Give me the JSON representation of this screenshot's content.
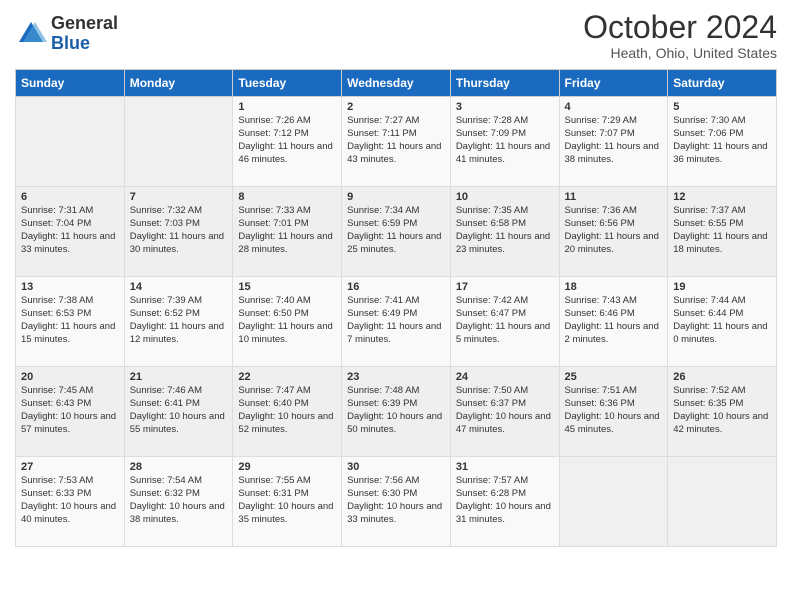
{
  "header": {
    "logo_general": "General",
    "logo_blue": "Blue",
    "title": "October 2024",
    "location": "Heath, Ohio, United States"
  },
  "days_of_week": [
    "Sunday",
    "Monday",
    "Tuesday",
    "Wednesday",
    "Thursday",
    "Friday",
    "Saturday"
  ],
  "weeks": [
    [
      {
        "day": "",
        "empty": true
      },
      {
        "day": "",
        "empty": true
      },
      {
        "day": "1",
        "sunrise": "Sunrise: 7:26 AM",
        "sunset": "Sunset: 7:12 PM",
        "daylight": "Daylight: 11 hours and 46 minutes."
      },
      {
        "day": "2",
        "sunrise": "Sunrise: 7:27 AM",
        "sunset": "Sunset: 7:11 PM",
        "daylight": "Daylight: 11 hours and 43 minutes."
      },
      {
        "day": "3",
        "sunrise": "Sunrise: 7:28 AM",
        "sunset": "Sunset: 7:09 PM",
        "daylight": "Daylight: 11 hours and 41 minutes."
      },
      {
        "day": "4",
        "sunrise": "Sunrise: 7:29 AM",
        "sunset": "Sunset: 7:07 PM",
        "daylight": "Daylight: 11 hours and 38 minutes."
      },
      {
        "day": "5",
        "sunrise": "Sunrise: 7:30 AM",
        "sunset": "Sunset: 7:06 PM",
        "daylight": "Daylight: 11 hours and 36 minutes."
      }
    ],
    [
      {
        "day": "6",
        "sunrise": "Sunrise: 7:31 AM",
        "sunset": "Sunset: 7:04 PM",
        "daylight": "Daylight: 11 hours and 33 minutes."
      },
      {
        "day": "7",
        "sunrise": "Sunrise: 7:32 AM",
        "sunset": "Sunset: 7:03 PM",
        "daylight": "Daylight: 11 hours and 30 minutes."
      },
      {
        "day": "8",
        "sunrise": "Sunrise: 7:33 AM",
        "sunset": "Sunset: 7:01 PM",
        "daylight": "Daylight: 11 hours and 28 minutes."
      },
      {
        "day": "9",
        "sunrise": "Sunrise: 7:34 AM",
        "sunset": "Sunset: 6:59 PM",
        "daylight": "Daylight: 11 hours and 25 minutes."
      },
      {
        "day": "10",
        "sunrise": "Sunrise: 7:35 AM",
        "sunset": "Sunset: 6:58 PM",
        "daylight": "Daylight: 11 hours and 23 minutes."
      },
      {
        "day": "11",
        "sunrise": "Sunrise: 7:36 AM",
        "sunset": "Sunset: 6:56 PM",
        "daylight": "Daylight: 11 hours and 20 minutes."
      },
      {
        "day": "12",
        "sunrise": "Sunrise: 7:37 AM",
        "sunset": "Sunset: 6:55 PM",
        "daylight": "Daylight: 11 hours and 18 minutes."
      }
    ],
    [
      {
        "day": "13",
        "sunrise": "Sunrise: 7:38 AM",
        "sunset": "Sunset: 6:53 PM",
        "daylight": "Daylight: 11 hours and 15 minutes."
      },
      {
        "day": "14",
        "sunrise": "Sunrise: 7:39 AM",
        "sunset": "Sunset: 6:52 PM",
        "daylight": "Daylight: 11 hours and 12 minutes."
      },
      {
        "day": "15",
        "sunrise": "Sunrise: 7:40 AM",
        "sunset": "Sunset: 6:50 PM",
        "daylight": "Daylight: 11 hours and 10 minutes."
      },
      {
        "day": "16",
        "sunrise": "Sunrise: 7:41 AM",
        "sunset": "Sunset: 6:49 PM",
        "daylight": "Daylight: 11 hours and 7 minutes."
      },
      {
        "day": "17",
        "sunrise": "Sunrise: 7:42 AM",
        "sunset": "Sunset: 6:47 PM",
        "daylight": "Daylight: 11 hours and 5 minutes."
      },
      {
        "day": "18",
        "sunrise": "Sunrise: 7:43 AM",
        "sunset": "Sunset: 6:46 PM",
        "daylight": "Daylight: 11 hours and 2 minutes."
      },
      {
        "day": "19",
        "sunrise": "Sunrise: 7:44 AM",
        "sunset": "Sunset: 6:44 PM",
        "daylight": "Daylight: 11 hours and 0 minutes."
      }
    ],
    [
      {
        "day": "20",
        "sunrise": "Sunrise: 7:45 AM",
        "sunset": "Sunset: 6:43 PM",
        "daylight": "Daylight: 10 hours and 57 minutes."
      },
      {
        "day": "21",
        "sunrise": "Sunrise: 7:46 AM",
        "sunset": "Sunset: 6:41 PM",
        "daylight": "Daylight: 10 hours and 55 minutes."
      },
      {
        "day": "22",
        "sunrise": "Sunrise: 7:47 AM",
        "sunset": "Sunset: 6:40 PM",
        "daylight": "Daylight: 10 hours and 52 minutes."
      },
      {
        "day": "23",
        "sunrise": "Sunrise: 7:48 AM",
        "sunset": "Sunset: 6:39 PM",
        "daylight": "Daylight: 10 hours and 50 minutes."
      },
      {
        "day": "24",
        "sunrise": "Sunrise: 7:50 AM",
        "sunset": "Sunset: 6:37 PM",
        "daylight": "Daylight: 10 hours and 47 minutes."
      },
      {
        "day": "25",
        "sunrise": "Sunrise: 7:51 AM",
        "sunset": "Sunset: 6:36 PM",
        "daylight": "Daylight: 10 hours and 45 minutes."
      },
      {
        "day": "26",
        "sunrise": "Sunrise: 7:52 AM",
        "sunset": "Sunset: 6:35 PM",
        "daylight": "Daylight: 10 hours and 42 minutes."
      }
    ],
    [
      {
        "day": "27",
        "sunrise": "Sunrise: 7:53 AM",
        "sunset": "Sunset: 6:33 PM",
        "daylight": "Daylight: 10 hours and 40 minutes."
      },
      {
        "day": "28",
        "sunrise": "Sunrise: 7:54 AM",
        "sunset": "Sunset: 6:32 PM",
        "daylight": "Daylight: 10 hours and 38 minutes."
      },
      {
        "day": "29",
        "sunrise": "Sunrise: 7:55 AM",
        "sunset": "Sunset: 6:31 PM",
        "daylight": "Daylight: 10 hours and 35 minutes."
      },
      {
        "day": "30",
        "sunrise": "Sunrise: 7:56 AM",
        "sunset": "Sunset: 6:30 PM",
        "daylight": "Daylight: 10 hours and 33 minutes."
      },
      {
        "day": "31",
        "sunrise": "Sunrise: 7:57 AM",
        "sunset": "Sunset: 6:28 PM",
        "daylight": "Daylight: 10 hours and 31 minutes."
      },
      {
        "day": "",
        "empty": true
      },
      {
        "day": "",
        "empty": true
      }
    ]
  ]
}
